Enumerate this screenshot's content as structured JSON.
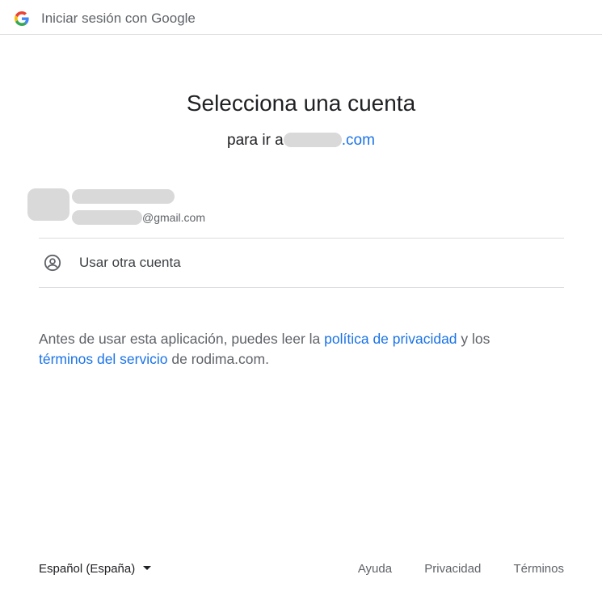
{
  "header": {
    "logo_icon": "google-g-icon",
    "title": "Iniciar sesión con Google"
  },
  "main": {
    "heading": "Selecciona una cuenta",
    "subheading_prefix": "para ir a",
    "subheading_suffix": ".com",
    "account": {
      "email_suffix": "@gmail.com"
    },
    "other_account": {
      "icon": "account-circle-icon",
      "label": "Usar otra cuenta"
    },
    "disclaimer": {
      "part1": "Antes de usar esta aplicación, puedes leer la ",
      "privacy_link": "política de privacidad",
      "part2": " y los ",
      "terms_link": "términos del servicio",
      "part3": " de rodima.com."
    }
  },
  "footer": {
    "language": "Español (España)",
    "links": [
      "Ayuda",
      "Privacidad",
      "Términos"
    ]
  },
  "colors": {
    "link": "#1a73e8",
    "text": "#202124",
    "muted": "#5f6368",
    "divider": "#dadce0",
    "redaction": "#d9d9d9"
  }
}
